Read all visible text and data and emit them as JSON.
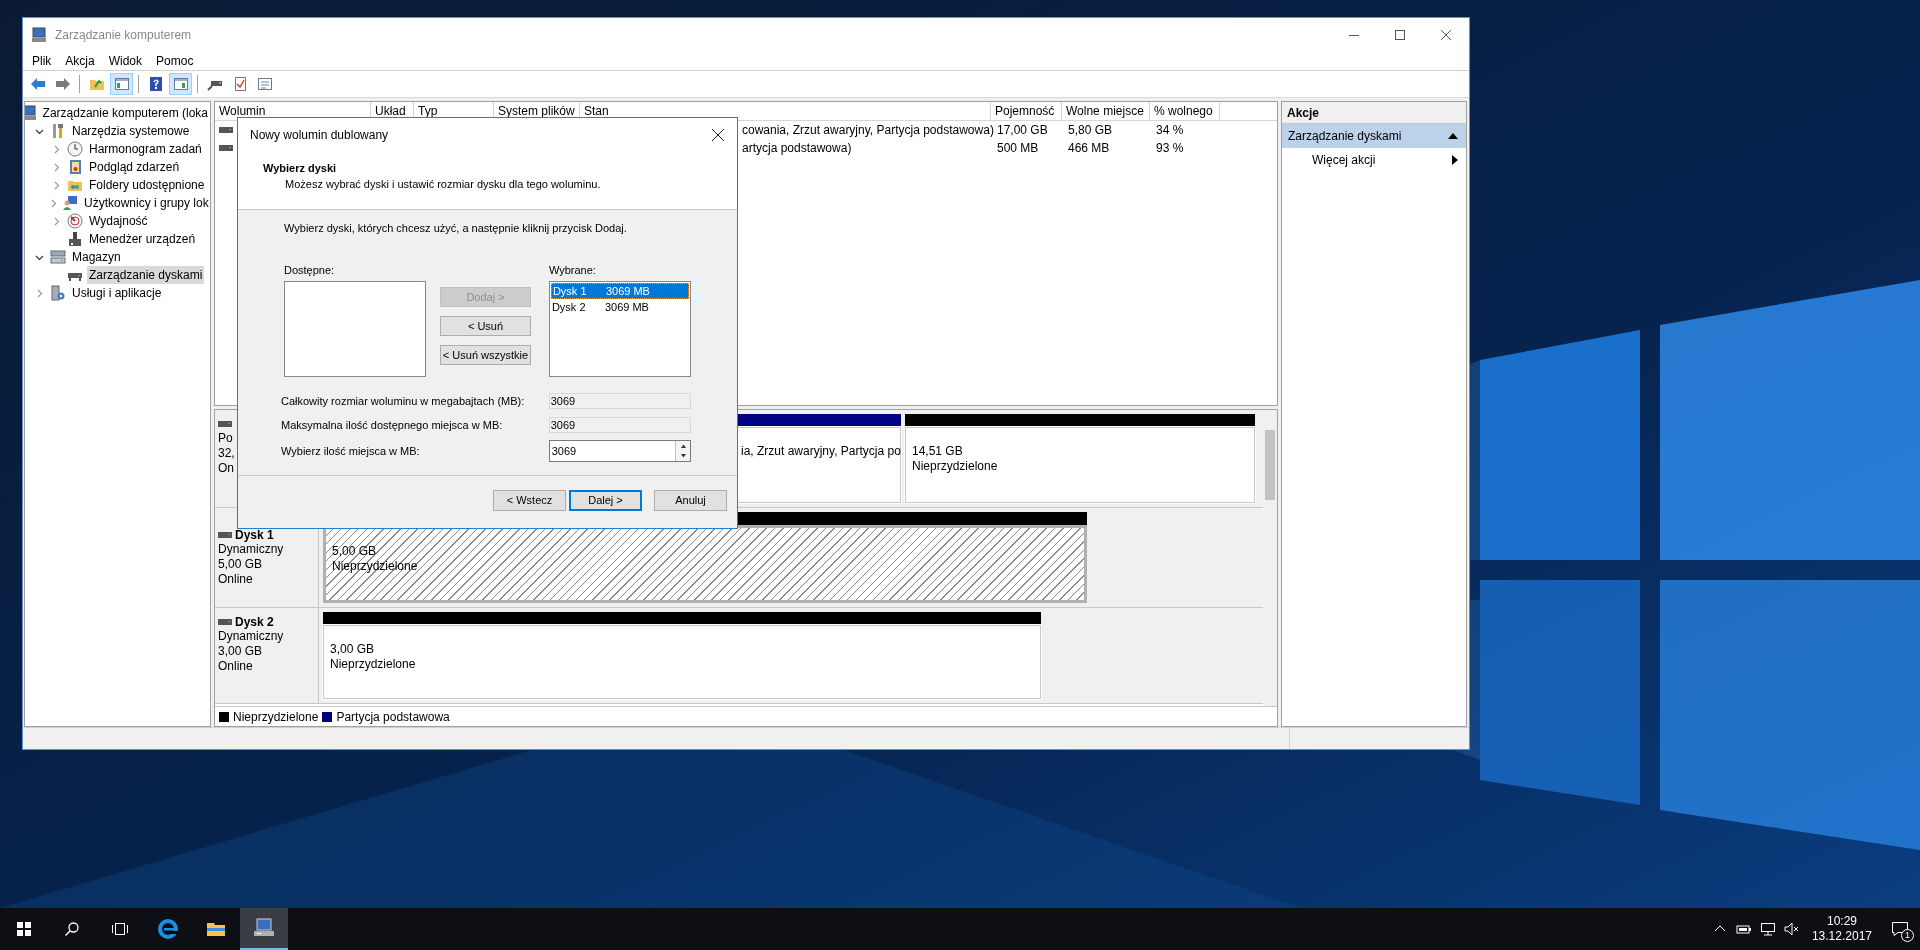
{
  "window": {
    "title": "Zarządzanie komputerem",
    "menu": [
      "Plik",
      "Akcja",
      "Widok",
      "Pomoc"
    ]
  },
  "toolbar": [
    {
      "kind": "back",
      "pressed": false
    },
    {
      "kind": "forward",
      "pressed": false
    },
    {
      "kind": "separator"
    },
    {
      "kind": "up",
      "pressed": false
    },
    {
      "kind": "console-tree",
      "pressed": true
    },
    {
      "kind": "separator"
    },
    {
      "kind": "help",
      "pressed": false
    },
    {
      "kind": "action-pane",
      "pressed": true
    },
    {
      "kind": "separator"
    },
    {
      "kind": "connect",
      "pressed": false
    },
    {
      "kind": "check",
      "pressed": false
    },
    {
      "kind": "properties",
      "pressed": false
    }
  ],
  "tree": {
    "root": {
      "label": "Zarządzanie komputerem (loka",
      "kind": "computer",
      "selected": false,
      "children": [
        {
          "label": "Narzędzia systemowe",
          "kind": "tools",
          "expanded": true,
          "selected": false,
          "children": [
            {
              "label": "Harmonogram zadań",
              "kind": "clock",
              "expanded": false,
              "selected": false
            },
            {
              "label": "Podgląd zdarzeń",
              "kind": "event-log",
              "expanded": false,
              "selected": false
            },
            {
              "label": "Foldery udostępnione",
              "kind": "shared-folders",
              "expanded": false,
              "selected": false
            },
            {
              "label": "Użytkownicy i grupy lok",
              "kind": "users",
              "expanded": false,
              "selected": false
            },
            {
              "label": "Wydajność",
              "kind": "performance",
              "expanded": false,
              "selected": false
            },
            {
              "label": "Menedżer urządzeń",
              "kind": "device",
              "selected": false
            }
          ]
        },
        {
          "label": "Magazyn",
          "kind": "storage",
          "expanded": true,
          "selected": false,
          "children": [
            {
              "label": "Zarządzanie dyskami",
              "kind": "disk",
              "selected": true
            }
          ]
        },
        {
          "label": "Usługi i aplikacje",
          "kind": "services",
          "expanded": false,
          "selected": false
        }
      ]
    }
  },
  "volumes": {
    "columns": [
      "Wolumin",
      "Układ",
      "Typ",
      "System plików",
      "Stan",
      "Pojemność",
      "Wolne miejsce",
      "% wolnego"
    ],
    "rows": [
      {
        "status": "cowania, Zrzut awaryjny, Partycja podstawowa)",
        "capacity": "17,00 GB",
        "free": "5,80 GB",
        "percent_free": "34 %"
      },
      {
        "status": "artycja podstawowa)",
        "capacity": "500 MB",
        "free": "466 MB",
        "percent_free": "93 %"
      }
    ]
  },
  "disks": [
    {
      "lines": [
        "Po",
        "32,",
        "On"
      ],
      "partitions": [
        {
          "kind": "primary",
          "selected": false,
          "lines": [
            "ia, Zrzut awaryjny, Partycja po"
          ]
        },
        {
          "kind": "unallocated",
          "selected": false,
          "lines": [
            "14,51 GB",
            "Nieprzydzielone"
          ]
        }
      ]
    },
    {
      "name": "Dysk 1",
      "lines": [
        "Dynamiczny",
        "5,00 GB",
        "Online"
      ],
      "partitions": [
        {
          "kind": "unallocated",
          "selected": true,
          "lines": [
            "5,00 GB",
            "Nieprzydzielone"
          ]
        }
      ]
    },
    {
      "name": "Dysk 2",
      "lines": [
        "Dynamiczny",
        "3,00 GB",
        "Online"
      ],
      "partitions": [
        {
          "kind": "unallocated",
          "selected": false,
          "lines": [
            "3,00 GB",
            "Nieprzydzielone"
          ]
        }
      ]
    }
  ],
  "legend": [
    {
      "label": "Nieprzydzielone",
      "color": "#000000"
    },
    {
      "label": "Partycja podstawowa",
      "color": "#000080"
    }
  ],
  "actions": {
    "title": "Akcje",
    "items": [
      {
        "kind": "group",
        "label": "Zarządzanie dyskami",
        "expanded": true
      },
      {
        "kind": "action",
        "label": "Więcej akcji",
        "submenu": true
      }
    ]
  },
  "dialog": {
    "title": "Nowy wolumin dublowany",
    "heading": "Wybierz dyski",
    "subtitle": "Możesz wybrać dyski i ustawić rozmiar dysku dla tego woluminu.",
    "instruction": "Wybierz dyski, których chcesz użyć, a następnie kliknij przycisk Dodaj.",
    "available_label": "Dostępne:",
    "selected_label": "Wybrane:",
    "move_buttons": [
      {
        "label": "Dodaj >",
        "disabled": true
      },
      {
        "label": "< Usuń",
        "disabled": false
      },
      {
        "label": "< Usuń wszystkie",
        "disabled": false
      }
    ],
    "selected_disks": [
      {
        "name": "Dysk 1",
        "size": "3069 MB",
        "selected": true
      },
      {
        "name": "Dysk 2",
        "size": "3069 MB",
        "selected": false
      }
    ],
    "fields": [
      {
        "kind": "readonly",
        "label": "Całkowity rozmiar woluminu w megabajtach (MB):",
        "value": "3069"
      },
      {
        "kind": "readonly",
        "label": "Maksymalna ilość dostępnego miejsca w MB:",
        "value": "3069"
      },
      {
        "kind": "spin",
        "label": "Wybierz ilość miejsca w MB:",
        "value": "3069"
      }
    ],
    "footer_buttons": [
      {
        "label": "< Wstecz",
        "default": false
      },
      {
        "label": "Dalej >",
        "default": true
      },
      {
        "label": "Anuluj",
        "default": false
      }
    ]
  },
  "taskbar": {
    "apps": [
      {
        "kind": "start",
        "active": false
      },
      {
        "kind": "search",
        "active": false
      },
      {
        "kind": "task-view",
        "active": false
      },
      {
        "kind": "browser",
        "active": false
      },
      {
        "kind": "explorer",
        "active": false
      },
      {
        "kind": "computer-management",
        "active": true
      }
    ],
    "clock": {
      "time": "10:29",
      "date": "13.12.2017"
    },
    "notifications": "1"
  }
}
